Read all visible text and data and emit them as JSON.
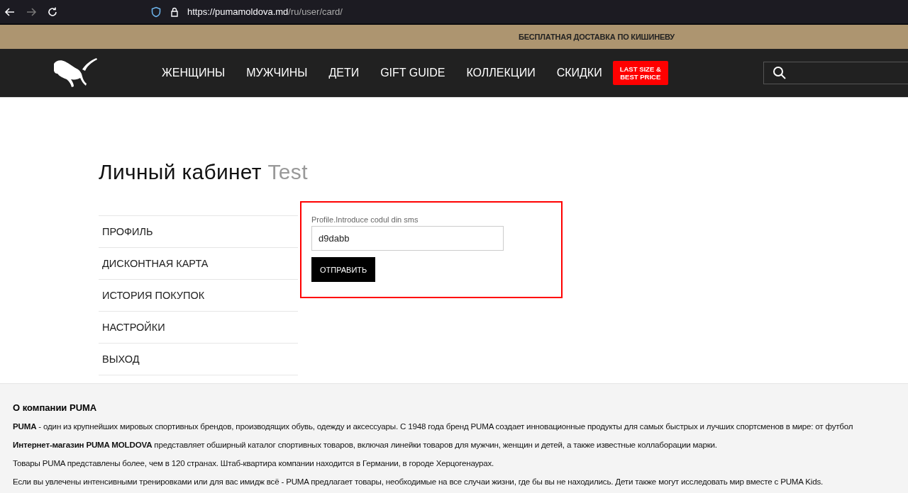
{
  "browser": {
    "url_host": "https://pumamoldova.md",
    "url_path": "/ru/user/card/"
  },
  "promo_banner": "БЕСПЛАТНАЯ ДОСТАВКА ПО КИШИНЕВУ",
  "nav": {
    "items": [
      "ЖЕНЩИНЫ",
      "МУЖЧИНЫ",
      "ДЕТИ",
      "GIFT GUIDE",
      "КОЛЛЕКЦИИ",
      "СКИДКИ"
    ],
    "sale_badge": [
      "LAST SIZE &",
      "BEST PRICE"
    ]
  },
  "page_title": {
    "text": "Личный кабинет",
    "user": "Test"
  },
  "sidebar": {
    "items": [
      "ПРОФИЛЬ",
      "ДИСКОНТНАЯ КАРТА",
      "ИСТОРИЯ ПОКУПОК",
      "НАСТРОЙКИ",
      "ВЫХОД"
    ]
  },
  "sms_form": {
    "label": "Profile.Introduce codul din sms",
    "value": "d9dabb",
    "button": "ОТПРАВИТЬ",
    "highlighted": true
  },
  "footer": {
    "title": "О компании PUMA",
    "paragraphs": [
      "**PUMA** - один из крупнейших мировых спортивных брендов, производящих обувь, одежду и аксессуары. С 1948 года бренд PUMA создает инновационные продукты для самых быстрых и лучших спортсменов в мире: от футбол",
      "**Интернет-магазин PUMA MOLDOVA** представляет обширный каталог спортивных товаров, включая линейки товаров для мужчин, женщин и детей, а также известные коллаборации марки.",
      "Товары PUMA представлены более, чем в 120 странах. Штаб-квартира компании находится в Германии, в городе Херцогенаурах.",
      "Если вы увлечены интенсивными тренировками или для вас имидж всё - PUMA предлагает товары, необходимые на все случаи жизни, где бы вы не находились. Дети также могут исследовать мир вместе с PUMA Kids."
    ]
  }
}
